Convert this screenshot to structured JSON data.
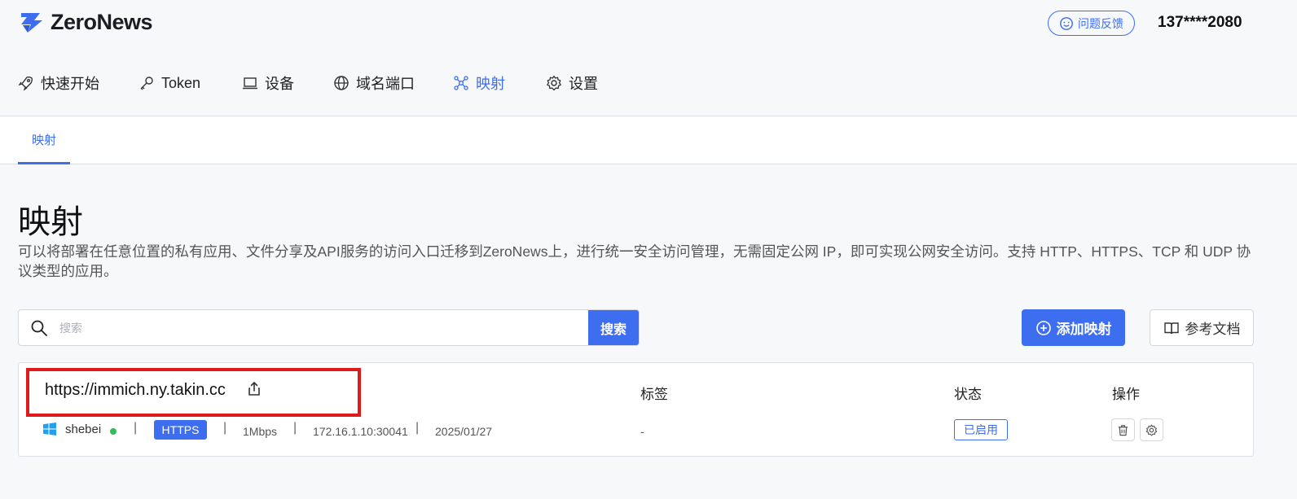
{
  "brand": {
    "name": "ZeroNews"
  },
  "header": {
    "feedback_label": "问题反馈",
    "user_phone": "137****2080"
  },
  "nav": [
    {
      "label": "快速开始",
      "icon": "rocket-icon"
    },
    {
      "label": "Token",
      "icon": "key-icon"
    },
    {
      "label": "设备",
      "icon": "laptop-icon"
    },
    {
      "label": "域名端口",
      "icon": "globe-icon"
    },
    {
      "label": "映射",
      "icon": "mapping-icon",
      "active": true
    },
    {
      "label": "设置",
      "icon": "gear-icon"
    }
  ],
  "subtab": {
    "label": "映射"
  },
  "page": {
    "title": "映射",
    "description": "可以将部署在任意位置的私有应用、文件分享及API服务的访问入口迁移到ZeroNews上，进行统一安全访问管理，无需固定公网 IP，即可实现公网安全访问。支持 HTTP、HTTPS、TCP 和 UDP 协议类型的应用。"
  },
  "search": {
    "placeholder": "搜索",
    "button_label": "搜索"
  },
  "actions": {
    "add_label": "添加映射",
    "docs_label": "参考文档"
  },
  "table": {
    "headers": {
      "tags": "标签",
      "status": "状态",
      "ops": "操作"
    }
  },
  "mapping": {
    "url": "https://immich.ny.takin.cc",
    "device": "shebei",
    "protocol": "HTTPS",
    "bandwidth": "1Mbps",
    "address": "172.16.1.10:30041",
    "date": "2025/01/27",
    "tags": "-",
    "status": "已启用"
  },
  "colors": {
    "accent": "#3d6ef0",
    "highlight": "#e01a1a",
    "online": "#2ebd59"
  }
}
